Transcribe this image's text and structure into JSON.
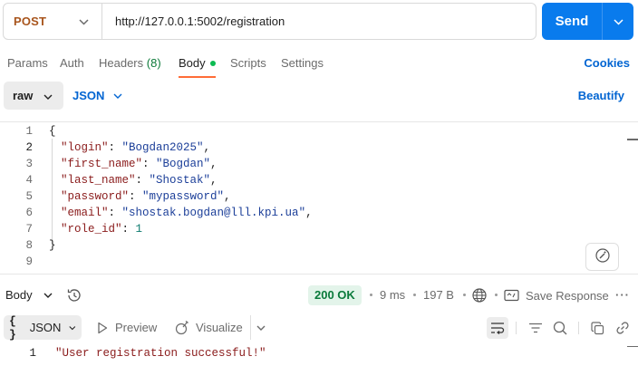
{
  "request": {
    "method": "POST",
    "url": "http://127.0.0.1:5002/registration",
    "send_label": "Send"
  },
  "tabs": [
    {
      "label": "Params"
    },
    {
      "label": "Auth"
    },
    {
      "label": "Headers",
      "count": "(8)"
    },
    {
      "label": "Body",
      "active": true,
      "has_content": true
    },
    {
      "label": "Scripts"
    },
    {
      "label": "Settings"
    }
  ],
  "cookies_label": "Cookies",
  "body_mode": "raw",
  "body_format": "JSON",
  "beautify_label": "Beautify",
  "editor": {
    "line_numbers": [
      "1",
      "2",
      "3",
      "4",
      "5",
      "6",
      "7",
      "8",
      "9"
    ],
    "current_line": 2,
    "fields": [
      {
        "key": "\"login\"",
        "value": "\"Bogdan2025\"",
        "comma": ","
      },
      {
        "key": "\"first_name\"",
        "value": "\"Bogdan\"",
        "comma": ","
      },
      {
        "key": "\"last_name\"",
        "value": "\"Shostak\"",
        "comma": ","
      },
      {
        "key": "\"password\"",
        "value": "\"mypassword\"",
        "comma": ","
      },
      {
        "key": "\"email\"",
        "value": "\"shostak.bogdan@lll.kpi.ua\"",
        "comma": ","
      },
      {
        "key": "\"role_id\"",
        "value": "1",
        "comma": ""
      }
    ],
    "open_brace": "{",
    "close_brace": "}",
    "colon": ": "
  },
  "response": {
    "section_label": "Body",
    "status": "200 OK",
    "time": "9 ms",
    "size": "197 B",
    "save_label": "Save Response",
    "more_label": "···",
    "format_label": "JSON",
    "format_braces": "{ }",
    "preview_label": "Preview",
    "visualize_label": "Visualize",
    "line_number": "1",
    "content": "\"User registration successful!\""
  },
  "colors": {
    "accent_blue": "#097bed",
    "method_post": "#a8551d",
    "tab_active_underline": "#ff6c37",
    "status_ok_bg": "#e3f4ea",
    "status_ok_text": "#0a7a3b",
    "json_key": "#8a1b1b",
    "json_string": "#1c3f99",
    "json_number": "#0b7a6e"
  },
  "icons": {
    "method_dropdown": "chevron-down-icon",
    "send_more": "chevron-down-icon",
    "history": "history-icon",
    "globe": "globe-icon",
    "save": "save-response-icon",
    "preview": "play-icon",
    "visualize": "visualize-icon",
    "wrap": "wrap-lines-icon",
    "filter": "filter-icon",
    "search": "search-icon",
    "copy": "copy-icon",
    "link": "link-icon",
    "magic": "magic-wand-icon"
  }
}
